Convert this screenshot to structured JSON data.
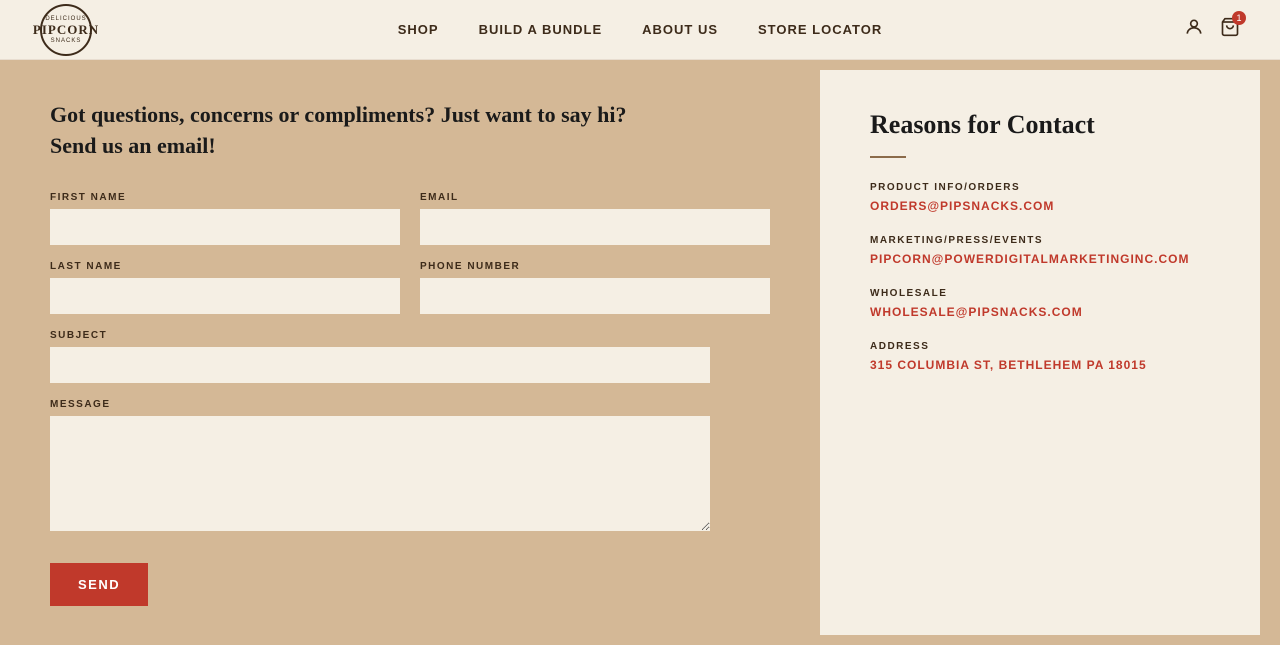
{
  "nav": {
    "logo_text_top": "Delicious",
    "logo_main": "PIPCORN",
    "logo_text_bottom": "Snacks",
    "links": [
      {
        "label": "SHOP",
        "href": "#"
      },
      {
        "label": "BUILD A BUNDLE",
        "href": "#"
      },
      {
        "label": "ABOUT US",
        "href": "#"
      },
      {
        "label": "STORE LOCATOR",
        "href": "#"
      }
    ],
    "cart_count": "1"
  },
  "page": {
    "headline_line1": "Got questions, concerns or compliments? Just want to say hi?",
    "headline_line2": "Send us an email!",
    "form": {
      "first_name_label": "FIRST NAME",
      "last_name_label": "LAST NAME",
      "email_label": "EMAIL",
      "phone_label": "PHONE NUMBER",
      "subject_label": "SUBJECT",
      "message_label": "MESSAGE",
      "send_button": "SEND"
    },
    "reasons": {
      "title": "Reasons for Contact",
      "items": [
        {
          "category": "PRODUCT INFO/ORDERS",
          "email": "ORDERS@PIPSNACKS.COM",
          "href": "mailto:orders@pipsnacks.com"
        },
        {
          "category": "MARKETING/PRESS/EVENTS",
          "email": "PIPCORN@POWERDIGITALMARKETINGINC.COM",
          "href": "mailto:pipcorn@powerdigitalmarketinginc.com"
        },
        {
          "category": "WHOLESALE",
          "email": "WHOLESALE@PIPSNACKS.COM",
          "href": "mailto:wholesale@pipsnacks.com"
        },
        {
          "category": "ADDRESS",
          "email": "315 COLUMBIA ST, BETHLEHEM PA 18015",
          "href": "#"
        }
      ]
    }
  }
}
